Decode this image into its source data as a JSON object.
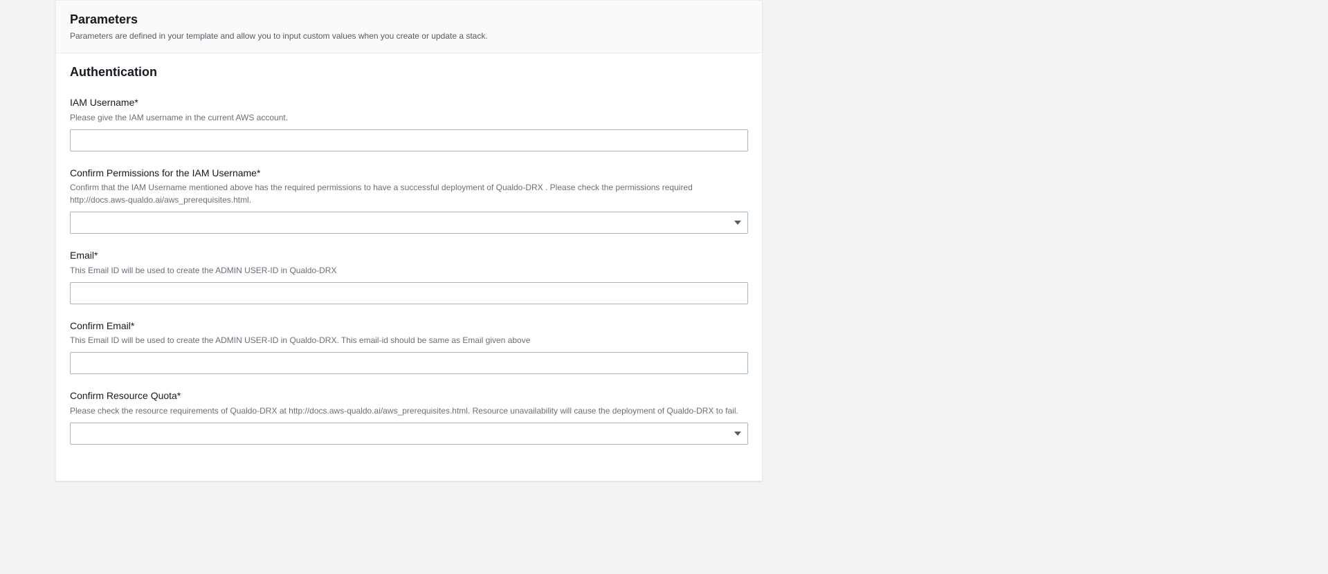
{
  "panel": {
    "title": "Parameters",
    "description": "Parameters are defined in your template and allow you to input custom values when you create or update a stack."
  },
  "section": {
    "title": "Authentication"
  },
  "fields": {
    "iam_username": {
      "label": "IAM Username*",
      "help": "Please give the IAM username in the current AWS account.",
      "value": ""
    },
    "confirm_permissions": {
      "label": "Confirm Permissions for the IAM Username*",
      "help": "Confirm that the IAM Username mentioned above has the required permissions to have a successful deployment of Qualdo-DRX . Please check the permissions required http://docs.aws-qualdo.ai/aws_prerequisites.html.",
      "value": ""
    },
    "email": {
      "label": "Email*",
      "help": "This Email ID will be used to create the ADMIN USER-ID in Qualdo-DRX",
      "value": ""
    },
    "confirm_email": {
      "label": "Confirm Email*",
      "help": "This Email ID will be used to create the ADMIN USER-ID in Qualdo-DRX. This email-id should be same as Email given above",
      "value": ""
    },
    "confirm_resource_quota": {
      "label": "Confirm Resource Quota*",
      "help": "Please check the resource requirements of Qualdo-DRX at http://docs.aws-qualdo.ai/aws_prerequisites.html. Resource unavailability will cause the deployment of Qualdo-DRX to fail.",
      "value": ""
    }
  }
}
